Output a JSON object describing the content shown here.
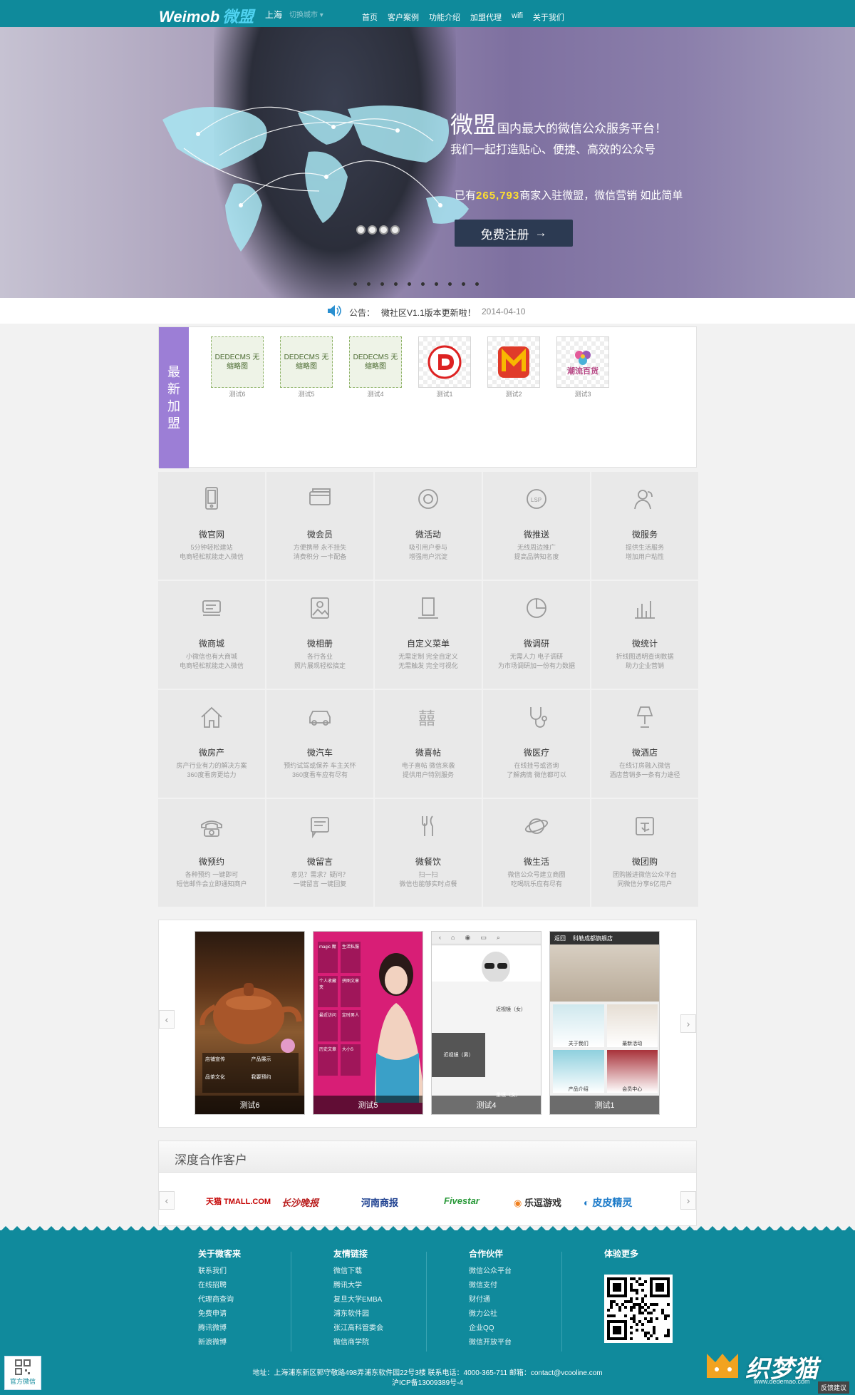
{
  "topbar": {
    "logo_en": "Weimob",
    "logo_cn": "微盟",
    "city": "上海",
    "city_switch": "切换城市 ▾",
    "nav": [
      "首页",
      "客户案例",
      "功能介绍",
      "加盟代理",
      "wifi",
      "关于我们"
    ]
  },
  "banner": {
    "slogan_big": "微盟",
    "slogan_rest": "国内最大的微信公众服务平台！",
    "slogan2": "我们一起打造贴心、便捷、高效的公众号",
    "merchants_prefix": "已有",
    "merchants_count": "265,793",
    "merchants_suffix": "商家入驻微盟，微信营销 如此简单",
    "register_label": "免费注册"
  },
  "notice": {
    "label": "公告：",
    "message": "微社区V1.1版本更新啦！",
    "date": "2014-04-10"
  },
  "newest": {
    "title": "最新加盟",
    "items": [
      {
        "name": "测试6",
        "thumb": "DEDECMS 无缩略图"
      },
      {
        "name": "测试5",
        "thumb": "DEDECMS 无缩略图"
      },
      {
        "name": "测试4",
        "thumb": "DEDECMS 无缩略图"
      },
      {
        "name": "测试1",
        "thumb": ""
      },
      {
        "name": "测试2",
        "thumb": ""
      },
      {
        "name": "测试3",
        "thumb": "潮流百货"
      }
    ]
  },
  "features": [
    {
      "title": "微官网",
      "desc1": "5分钟轻松建站",
      "desc2": "电商轻松就能走入微信",
      "icon": "phone-icon"
    },
    {
      "title": "微会员",
      "desc1": "方便携带 永不挂失",
      "desc2": "消费积分 一卡配备",
      "icon": "card-icon"
    },
    {
      "title": "微活动",
      "desc1": "吸引用户参与",
      "desc2": "增强用户沉淀",
      "icon": "gift-icon"
    },
    {
      "title": "微推送",
      "desc1": "无线周边推广",
      "desc2": "提高品牌知名度",
      "icon": "lsp-icon"
    },
    {
      "title": "微服务",
      "desc1": "提供生活服务",
      "desc2": "增加用户粘性",
      "icon": "user-icon"
    },
    {
      "title": "微商城",
      "desc1": "小微信也有大商城",
      "desc2": "电商轻松就能走入微信",
      "icon": "cart-icon"
    },
    {
      "title": "微相册",
      "desc1": "各行各业",
      "desc2": "照片展现轻松搞定",
      "icon": "photo-icon"
    },
    {
      "title": "自定义菜单",
      "desc1": "无需定制 完全自定义",
      "desc2": "无需触发 完全可视化",
      "icon": "tablet-icon"
    },
    {
      "title": "微调研",
      "desc1": "无需人力 电子调研",
      "desc2": "为市场调研加一份有力数据",
      "icon": "pie-icon"
    },
    {
      "title": "微统计",
      "desc1": "折线图透明查询数据",
      "desc2": "助力企业营销",
      "icon": "chart-icon"
    },
    {
      "title": "微房产",
      "desc1": "房产行业有力的解决方案",
      "desc2": "360度看房更给力",
      "icon": "house-icon"
    },
    {
      "title": "微汽车",
      "desc1": "预约试驾或保养 车主关怀",
      "desc2": "360度看车应有尽有",
      "icon": "car-icon"
    },
    {
      "title": "微喜帖",
      "desc1": "电子喜帖 微信来袭",
      "desc2": "提供用户特别服务",
      "icon": "xi-icon"
    },
    {
      "title": "微医疗",
      "desc1": "在线挂号或咨询",
      "desc2": "了解病情 微信都可以",
      "icon": "stethoscope-icon"
    },
    {
      "title": "微酒店",
      "desc1": "在线订房融入微信",
      "desc2": "酒店营销多一条有力途径",
      "icon": "lamp-icon"
    },
    {
      "title": "微预约",
      "desc1": "各种预约 一键即可",
      "desc2": "短信邮件会立即通知商户",
      "icon": "telephone-icon"
    },
    {
      "title": "微留言",
      "desc1": "意见？需求？疑问？",
      "desc2": "一键留言 一键回复",
      "icon": "message-icon"
    },
    {
      "title": "微餐饮",
      "desc1": "扫一扫",
      "desc2": "微信也能够实时点餐",
      "icon": "fork-knife-icon"
    },
    {
      "title": "微生活",
      "desc1": "微信公众号建立商圈",
      "desc2": "吃喝玩乐应有尽有",
      "icon": "planet-icon"
    },
    {
      "title": "微团购",
      "desc1": "团购搬进微信公众平台",
      "desc2": "同微信分享6亿用户",
      "icon": "group-buy-icon"
    }
  ],
  "cases": [
    "测试6",
    "测试5",
    "测试4",
    "测试1"
  ],
  "case_screens": {
    "c1": [
      "店铺宣传",
      "产品展示",
      "品茶文化",
      "我要预约"
    ],
    "c2": [
      "magic 魔",
      "生活私服",
      "个人收藏夹",
      "拼图文章",
      "最近访问",
      "定时男人",
      "历史文章",
      "大小S"
    ],
    "c3": [
      "近视镜（女）",
      "近视镜（男）",
      "墨镜（女）"
    ],
    "c4_title": "科勒成都旗舰店",
    "c4_back": "返回",
    "c4": [
      "关于我们",
      "最新活动",
      "产品介绍",
      "会员中心"
    ]
  },
  "partners": {
    "title": "深度合作客户",
    "logos": [
      {
        "name": "天猫 TMALL.COM",
        "color": "#c40000"
      },
      {
        "name": "长沙晚报",
        "color": "#b81c1c"
      },
      {
        "name": "河南商报",
        "color": "#1b3e8f"
      },
      {
        "name": "Fivestar",
        "color": "#2a9a3a"
      },
      {
        "name": "乐逗游戏",
        "color": "#333333"
      },
      {
        "name": "皮皮精灵",
        "color": "#1b7ac8"
      }
    ]
  },
  "footer": {
    "col1": {
      "title": "关于微客来",
      "items": [
        "联系我们",
        "在线招聘",
        "代理商查询",
        "免费申请",
        "腾讯微博",
        "新浪微博"
      ]
    },
    "col2": {
      "title": "友情链接",
      "items": [
        "微信下载",
        "腾讯大学",
        "复旦大学EMBA",
        "浦东软件园",
        "张江高科管委会",
        "微信商学院"
      ]
    },
    "col3": {
      "title": "合作伙伴",
      "items": [
        "微信公众平台",
        "微信支付",
        "财付通",
        "微力公社",
        "企业QQ",
        "微信开放平台"
      ]
    },
    "col4": {
      "title": "体验更多"
    },
    "address": "地址：上海浦东新区郭守敬路498弄浦东软件园22号3楼 联系电话：4000-365-711 邮箱：contact@vcooline.com",
    "icp": "沪ICP备13009389号-4",
    "wechat_label": "官方微信",
    "watermark": "织梦猫",
    "watermark_url": "www.dedemao.com",
    "feedback": "反馈建议"
  },
  "colors": {
    "brand": "#0f8a9b",
    "newest_purple": "#9c7ed6",
    "highlight_yellow": "#ffe02e"
  }
}
